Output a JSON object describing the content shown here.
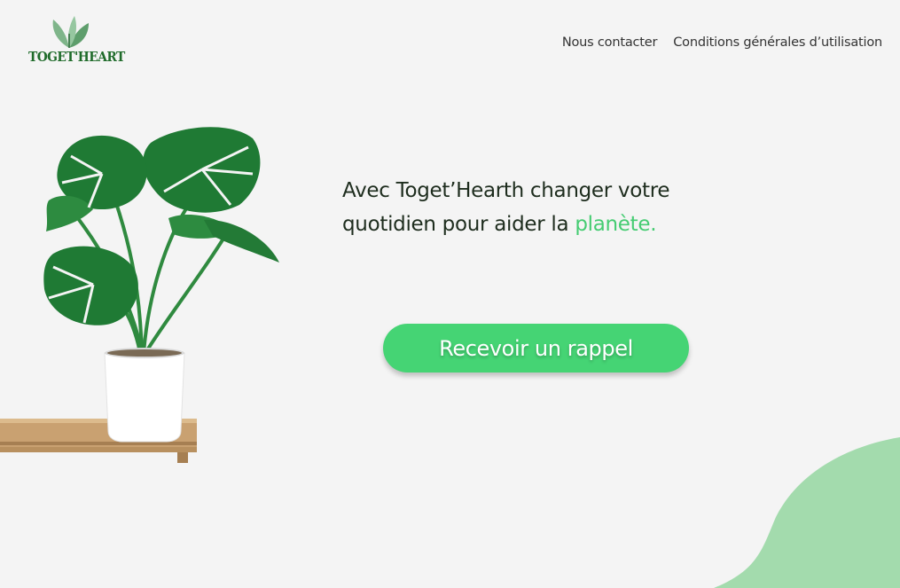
{
  "header": {
    "logo_text": "TOGET'HEART",
    "nav": [
      {
        "label": "Nous contacter"
      },
      {
        "label": "Conditions générales d’utilisation"
      }
    ]
  },
  "hero": {
    "headline_line1": "Avec Toget’Hearth changer votre",
    "headline_line2_start": "quotidien pour aider la ",
    "headline_accent": "planète.",
    "cta_label": "Recevoir un rappel"
  },
  "colors": {
    "accent": "#45cc72",
    "button": "#45d474",
    "blob": "#a3dbad",
    "logo": "#1f6b2a",
    "background": "#f4f4f4"
  }
}
